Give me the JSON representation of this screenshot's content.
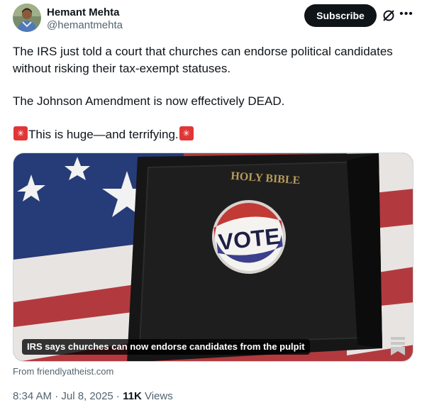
{
  "author": {
    "name": "Hemant Mehta",
    "handle": "@hemantmehta"
  },
  "actions": {
    "subscribe_label": "Subscribe",
    "grok_icon": "grok-icon",
    "more_icon": "more-horizontal-icon"
  },
  "tweet": {
    "line1": "The IRS just told a court that churches can endorse political candidates",
    "line2": "without risking their tax-exempt statuses.",
    "line3": "The Johnson Amendment is now effectively DEAD.",
    "line4": "This is huge—and terrifying."
  },
  "card": {
    "caption": "IRS says churches can now endorse candidates from the pulpit",
    "bible_label": "HOLY BIBLE",
    "button_label": "VOTE",
    "source": "From friendlyatheist.com"
  },
  "meta": {
    "time": "8:34 AM · Jul 8, 2025 · ",
    "views_count": "11K",
    "views_label": " Views"
  },
  "colors": {
    "subscribe_bg": "#0f1419",
    "text": "#0f1419",
    "secondary": "#536471",
    "emoji_red": "#e23636"
  }
}
